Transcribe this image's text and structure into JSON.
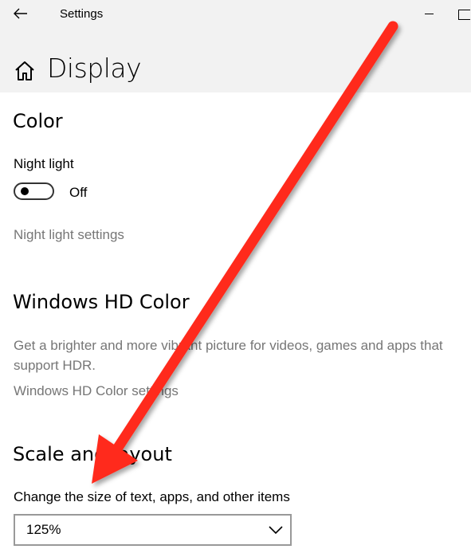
{
  "window": {
    "title": "Settings"
  },
  "page": {
    "title": "Display"
  },
  "sections": {
    "color": {
      "heading": "Color",
      "night_light_label": "Night light",
      "toggle_state": "Off",
      "settings_link": "Night light settings"
    },
    "hd_color": {
      "heading": "Windows HD Color",
      "description": "Get a brighter and more vibrant picture for videos, games and apps that support HDR.",
      "settings_link": "Windows HD Color settings"
    },
    "scale_layout": {
      "heading": "Scale and layout",
      "size_label": "Change the size of text, apps, and other items",
      "size_value": "125%"
    }
  },
  "icons": {
    "back": "back-arrow-icon",
    "home": "home-icon",
    "chevron": "chevron-down-icon"
  },
  "colors": {
    "annotation_arrow": "#ff2a1a",
    "titlebar_bg": "#f2f2f2",
    "link_gray": "#767676"
  }
}
